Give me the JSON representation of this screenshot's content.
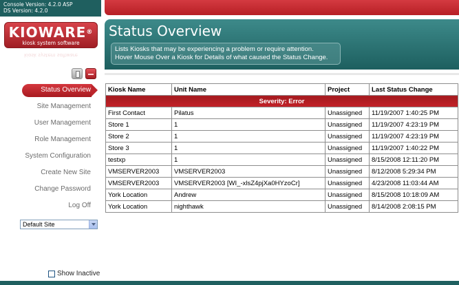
{
  "sidebar": {
    "console_version": "Console Version: 4.2.0 ASP",
    "ds_version": "DS Version: 4.2.0",
    "logo": {
      "name": "KIOWARE",
      "registered": "®",
      "tagline": "kiosk system software",
      "reflection": "kiosk system software"
    },
    "nav": [
      {
        "label": "Status Overview",
        "active": true
      },
      {
        "label": "Site Management",
        "active": false
      },
      {
        "label": "User Management",
        "active": false
      },
      {
        "label": "Role Management",
        "active": false
      },
      {
        "label": "System Configuration",
        "active": false
      },
      {
        "label": "Create New Site",
        "active": false
      },
      {
        "label": "Change Password",
        "active": false
      },
      {
        "label": "Log Off",
        "active": false
      }
    ],
    "site_select": {
      "selected": "Default Site"
    },
    "show_inactive": {
      "label": "Show Inactive",
      "checked": false
    }
  },
  "header": {
    "title": "Status Overview",
    "description_line_1": "Lists Kiosks that may be experiencing a problem or require attention.",
    "description_line_2": "Hover Mouse Over a Kiosk for Details of what caused the Status Change."
  },
  "table": {
    "columns": [
      "Kiosk Name",
      "Unit Name",
      "Project",
      "Last Status Change"
    ],
    "severity_label": "Severity: Error",
    "rows": [
      [
        "First Contact",
        "Pilatus",
        "Unassigned",
        "11/19/2007 1:40:25 PM"
      ],
      [
        "Store 1",
        "1",
        "Unassigned",
        "11/19/2007 4:23:19 PM"
      ],
      [
        "Store 2",
        "1",
        "Unassigned",
        "11/19/2007 4:23:19 PM"
      ],
      [
        "Store 3",
        "1",
        "Unassigned",
        "11/19/2007 1:40:22 PM"
      ],
      [
        "testxp",
        "1",
        "Unassigned",
        "8/15/2008 12:11:20 PM"
      ],
      [
        "VMSERVER2003",
        "VMSERVER2003",
        "Unassigned",
        "8/12/2008 5:29:34 PM"
      ],
      [
        "VMSERVER2003",
        "VMSERVER2003 [WI_-xlsZ4pjXa0HYzoCr]",
        "Unassigned",
        "4/23/2008 11:03:44 AM"
      ],
      [
        "York Location",
        "Andrew",
        "Unassigned",
        "8/15/2008 10:18:09 AM"
      ],
      [
        "York Location",
        "nighthawk",
        "Unassigned",
        "8/14/2008 2:08:15 PM"
      ]
    ]
  },
  "colors": {
    "teal_dark": "#1f5f5f",
    "teal_light": "#3d8a8a",
    "red": "#c32228",
    "nav_text": "#6b6b6b"
  },
  "icons": {
    "gray_button": "page-icon",
    "red_button": "minimize-icon",
    "select_arrow": "chevron-down-icon"
  }
}
